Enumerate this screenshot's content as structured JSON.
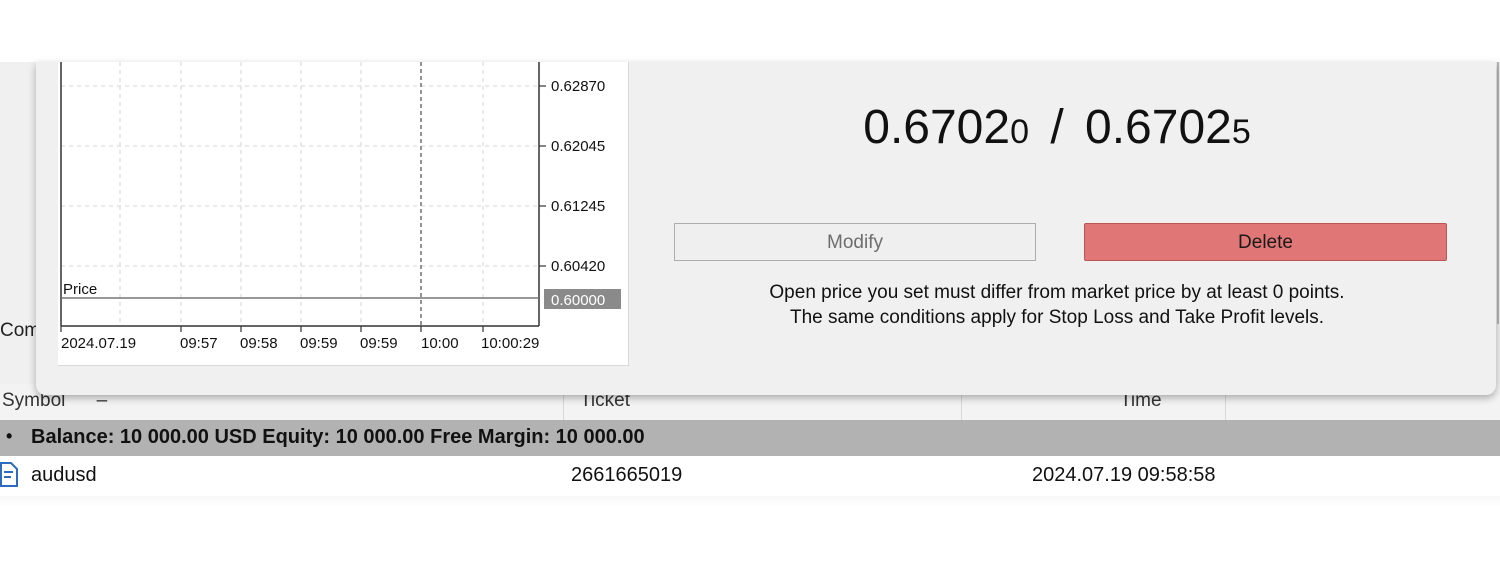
{
  "background": {
    "tab_partial_label": "Com",
    "table_headers": [
      "Symbol",
      "Ticket",
      "Time"
    ],
    "sort_indicator": "–",
    "balance_bullet": "•",
    "balance_text": "Balance: 10 000.00 USD  Equity: 10 000.00  Free Margin: 10 000.00",
    "orders": [
      {
        "icon": "order-document-icon",
        "symbol": "audusd",
        "ticket": "2661665019",
        "time": "2024.07.19 09:58:58"
      }
    ]
  },
  "dialog": {
    "chart": {
      "price_line_label": "Price",
      "y_tick_labels": [
        "0.62870",
        "0.62045",
        "0.61245",
        "0.60420"
      ],
      "price_level_label": "0.60000",
      "x_tick_labels": [
        "2024.07.19",
        "09:57",
        "09:58",
        "09:59",
        "09:59",
        "10:00",
        "10:00:29"
      ]
    },
    "quote": {
      "bid_main": "0.6702",
      "bid_small": "0",
      "separator": "/",
      "ask_main": "0.6702",
      "ask_small": "5"
    },
    "buttons": {
      "modify": "Modify",
      "delete": "Delete"
    },
    "info_line1": "Open price you set must differ from market price by at least 0 points.",
    "info_line2": "The same conditions apply for Stop Loss and Take Profit levels.",
    "colors": {
      "delete_button": "#e07676",
      "price_level_background": "#8a8a8a",
      "selected_row": "#b2b2b2"
    }
  }
}
